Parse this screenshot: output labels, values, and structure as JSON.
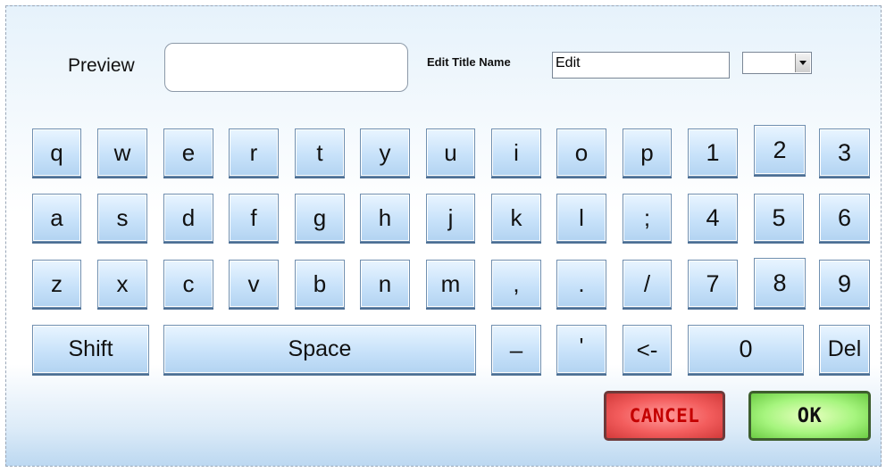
{
  "header": {
    "preview_label": "Preview",
    "preview_value": "",
    "title_label": "Edit Title Name",
    "title_value": "Edit",
    "dropdown_value": ""
  },
  "keyboard": {
    "row1": [
      "q",
      "w",
      "e",
      "r",
      "t",
      "y",
      "u",
      "i",
      "o",
      "p",
      "1",
      "2",
      "3"
    ],
    "row2": [
      "a",
      "s",
      "d",
      "f",
      "g",
      "h",
      "j",
      "k",
      "l",
      ";",
      "4",
      "5",
      "6"
    ],
    "row3": [
      "z",
      "x",
      "c",
      "v",
      "b",
      "n",
      "m",
      ",",
      ".",
      "/",
      "7",
      "8",
      "9"
    ],
    "row4": {
      "shift": "Shift",
      "space": "Space",
      "dash": "–",
      "apostrophe": "'",
      "backspace": "<-",
      "zero": "0",
      "del": "Del"
    }
  },
  "actions": {
    "cancel": "CANCEL",
    "ok": "OK"
  },
  "colors": {
    "key_fill": "#c8e2fa",
    "cancel_fill": "#f35d5d",
    "ok_fill": "#a6f57e"
  }
}
